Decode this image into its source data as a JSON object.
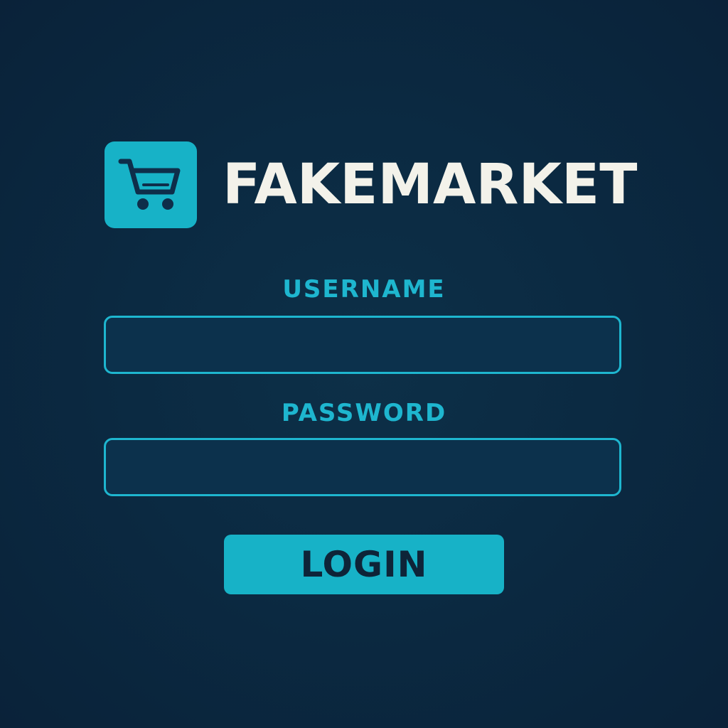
{
  "brand": {
    "name": "FAKEMARKET",
    "icon": "shopping-cart-icon",
    "accent_color": "#17b2c7"
  },
  "form": {
    "username_label": "USERNAME",
    "username_value": "",
    "password_label": "PASSWORD",
    "password_value": "",
    "login_label": "LOGIN"
  },
  "colors": {
    "background": "#0b2a42",
    "accent": "#1eb6cf",
    "brand_text": "#f3f2ea",
    "button_text": "#0e2438"
  }
}
